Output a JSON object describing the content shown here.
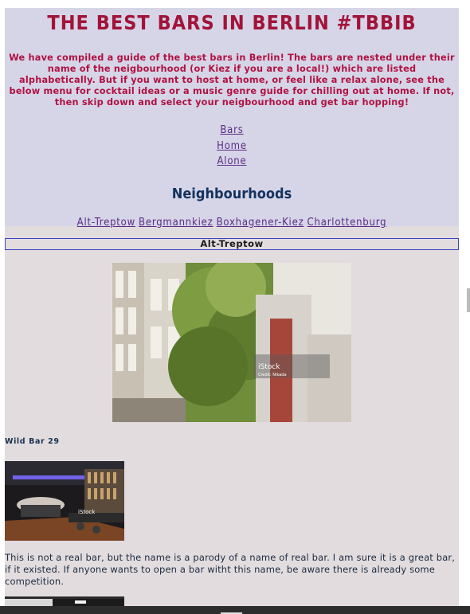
{
  "header": {
    "title": "THE BEST BARS IN BERLIN #TBBIB",
    "intro": "We have compiled a guide of the best bars in Berlin! The bars are nested under their name of the neigbourhood (or Kiez if you are a local!) which are listed alphabetically. But if you want to host at home, or feel like a relax alone, see the below menu for cocktail ideas or a music genre guide for chilling out at home. If not, then skip down and select your neigbourhood and get bar hopping!",
    "nav": [
      "Bars",
      "Home",
      "Alone"
    ],
    "subtitle": "Neighbourhoods",
    "neighbourhoods": [
      "Alt-Treptow",
      "Bergmannkiez",
      "Boxhagener-Kiez",
      "Charlottenburg"
    ]
  },
  "section": {
    "title": "Alt-Treptow",
    "hero_watermark": "iStock",
    "hero_credit": "Credit: Nikada"
  },
  "bar": {
    "name": "Wild Bar 29",
    "photo_watermark": "iStock",
    "description": "This is not a real bar, but the name is a parody of a name of real bar. I am sure it is a great bar, if it existed. If anyone wants to open a bar witht this name, be aware there is already some competition."
  },
  "colors": {
    "title": "#a21339",
    "header_bg": "#d6d5e7",
    "page_bg": "#e3dcdf",
    "link": "#5b2b86",
    "subtitle": "#13325e"
  }
}
